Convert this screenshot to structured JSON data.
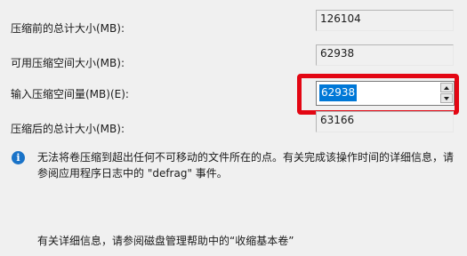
{
  "fields": {
    "total_before": {
      "label": "压缩前的总计大小(MB):",
      "value": "126104"
    },
    "available": {
      "label": "可用压缩空间大小(MB):",
      "value": "62938"
    },
    "shrink_amount": {
      "label": "输入压缩空间量(MB)(E):",
      "value": "62938"
    },
    "total_after": {
      "label": "压缩后的总计大小(MB):",
      "value": "63166"
    }
  },
  "info": {
    "icon": "info-icon",
    "line1": "无法将卷压缩到超出任何不可移动的文件所在的点。有关完成该操作时间的详细信息，请",
    "line2": "参阅应用程序日志中的 \"defrag\" 事件。"
  },
  "help": {
    "text": "有关详细信息，请参阅磁盘管理帮助中的“收缩基本卷”"
  },
  "colors": {
    "highlight": "#e30613",
    "selection": "#0078d7",
    "info_icon": "#1a73c8"
  }
}
